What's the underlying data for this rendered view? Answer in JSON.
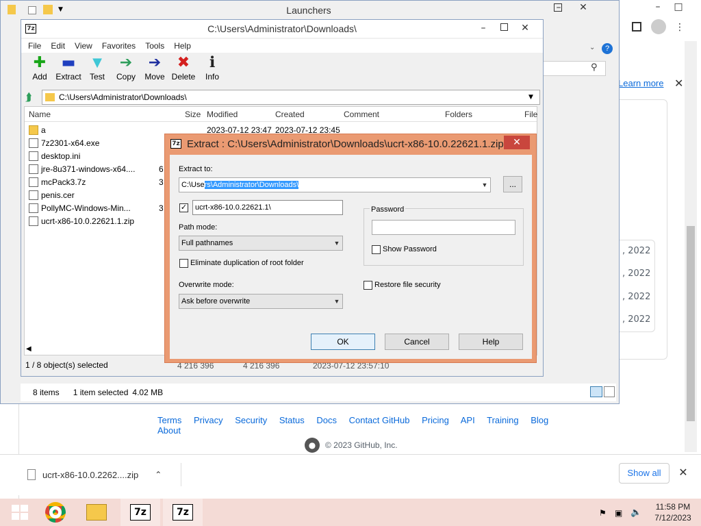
{
  "browser": {
    "learn_more": "Learn more",
    "dates": [
      ", 2022",
      ", 2022",
      ", 2022",
      ", 2022"
    ],
    "footer_links": [
      "Terms",
      "Privacy",
      "Security",
      "Status",
      "Docs",
      "Contact GitHub",
      "Pricing",
      "API",
      "Training",
      "Blog",
      "About"
    ],
    "copyright": "© 2023 GitHub, Inc.",
    "download_file": "ucrt-x86-10.0.2262....zip",
    "show_all": "Show all"
  },
  "launchers": {
    "title": "Launchers",
    "status_items": "8 items",
    "status_selected": "1 item selected",
    "status_size": "4.02 MB"
  },
  "sevenzip": {
    "title": "C:\\Users\\Administrator\\Downloads\\",
    "menu": [
      "File",
      "Edit",
      "View",
      "Favorites",
      "Tools",
      "Help"
    ],
    "toolbar": [
      {
        "label": "Add",
        "icon": "add-icon",
        "glyph": "✚",
        "color": "#19a619"
      },
      {
        "label": "Extract",
        "icon": "extract-icon",
        "glyph": "▬",
        "color": "#1f3fbf"
      },
      {
        "label": "Test",
        "icon": "test-icon",
        "glyph": "▼",
        "color": "#3fc7d6"
      },
      {
        "label": "Copy",
        "icon": "copy-icon",
        "glyph": "➔",
        "color": "#2e9e5b"
      },
      {
        "label": "Move",
        "icon": "move-icon",
        "glyph": "➔",
        "color": "#1f2f9f"
      },
      {
        "label": "Delete",
        "icon": "delete-icon",
        "glyph": "✖",
        "color": "#d4201f"
      },
      {
        "label": "Info",
        "icon": "info-icon",
        "glyph": "ℹ",
        "color": "#222222"
      }
    ],
    "address": "C:\\Users\\Administrator\\Downloads\\",
    "columns": [
      "Name",
      "Size",
      "Modified",
      "Created",
      "Comment",
      "Folders",
      "File"
    ],
    "files": [
      {
        "name": "a",
        "type": "folder",
        "size": "",
        "modified": "2023-07-12 23:47",
        "created": "2023-07-12 23:45"
      },
      {
        "name": "7z2301-x64.exe",
        "type": "exe",
        "size": "",
        "modified": "",
        "created": ""
      },
      {
        "name": "desktop.ini",
        "type": "ini",
        "size": "",
        "modified": "",
        "created": ""
      },
      {
        "name": "jre-8u371-windows-x64....",
        "type": "exe",
        "size": "6",
        "modified": "",
        "created": ""
      },
      {
        "name": "mcPack3.7z",
        "type": "7z",
        "size": "3",
        "modified": "",
        "created": ""
      },
      {
        "name": "penis.cer",
        "type": "cer",
        "size": "",
        "modified": "",
        "created": ""
      },
      {
        "name": "PollyMC-Windows-Min...",
        "type": "exe",
        "size": "3",
        "modified": "",
        "created": ""
      },
      {
        "name": "ucrt-x86-10.0.22621.1.zip",
        "type": "zip",
        "size": "",
        "modified": "",
        "created": ""
      }
    ],
    "status_selected": "1 / 8 object(s) selected",
    "status_size1": "4 216 396",
    "status_size2": "4 216 396",
    "status_date": "2023-07-12 23:57:10"
  },
  "extract_dialog": {
    "title": "Extract : C:\\Users\\Administrator\\Downloads\\ucrt-x86-10.0.22621.1.zip",
    "extract_to_label": "Extract to:",
    "extract_to_prefix": "C:\\Use",
    "extract_to_selected": "rs\\Administrator\\Downloads\\",
    "browse_label": "...",
    "subfolder_checked": true,
    "subfolder_value": "ucrt-x86-10.0.22621.1\\",
    "path_mode_label": "Path mode:",
    "path_mode_value": "Full pathnames",
    "eliminate_label": "Eliminate duplication of root folder",
    "overwrite_label": "Overwrite mode:",
    "overwrite_value": "Ask before overwrite",
    "password_label": "Password",
    "show_password_label": "Show Password",
    "restore_security_label": "Restore file security",
    "ok_label": "OK",
    "cancel_label": "Cancel",
    "help_label": "Help"
  },
  "taskbar": {
    "time": "11:58 PM",
    "date": "7/12/2023"
  }
}
